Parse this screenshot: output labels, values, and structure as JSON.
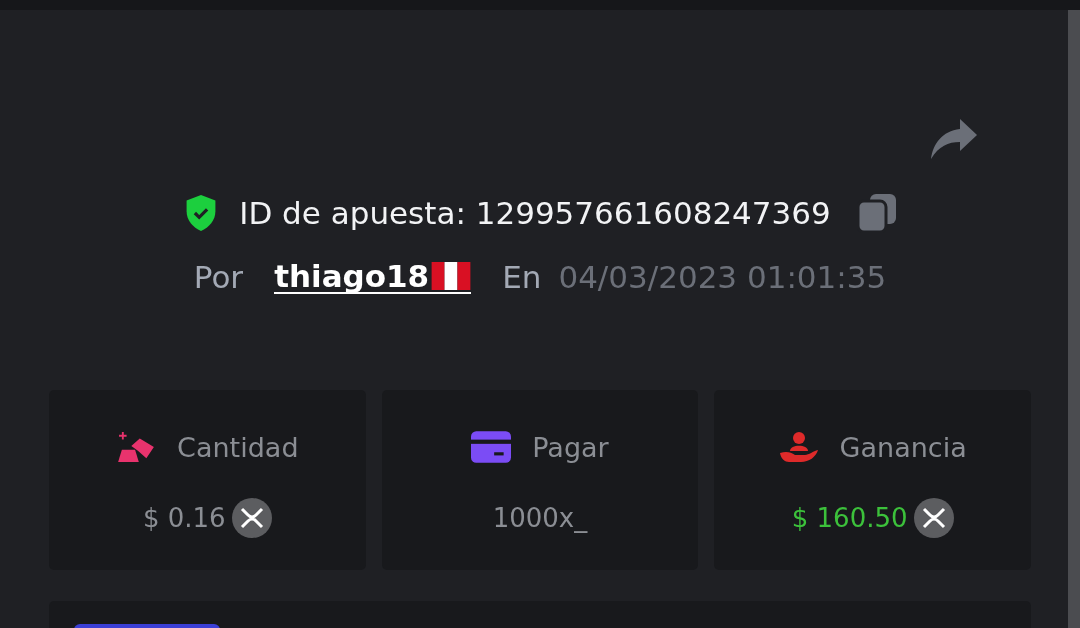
{
  "bet": {
    "id_text": "ID de apuesta: 129957661608247369",
    "by_label": "Por",
    "username": "thiago18",
    "at_label": "En",
    "datetime": "04/03/2023 01:01:35"
  },
  "stats": [
    {
      "kind": "amount",
      "label": "Cantidad",
      "value": "$ 0.16",
      "coin": true
    },
    {
      "kind": "payout",
      "label": "Pagar",
      "value": "1000x_",
      "coin": false
    },
    {
      "kind": "profit",
      "label": "Ganancia",
      "value": "$ 160.50",
      "coin": true
    }
  ]
}
